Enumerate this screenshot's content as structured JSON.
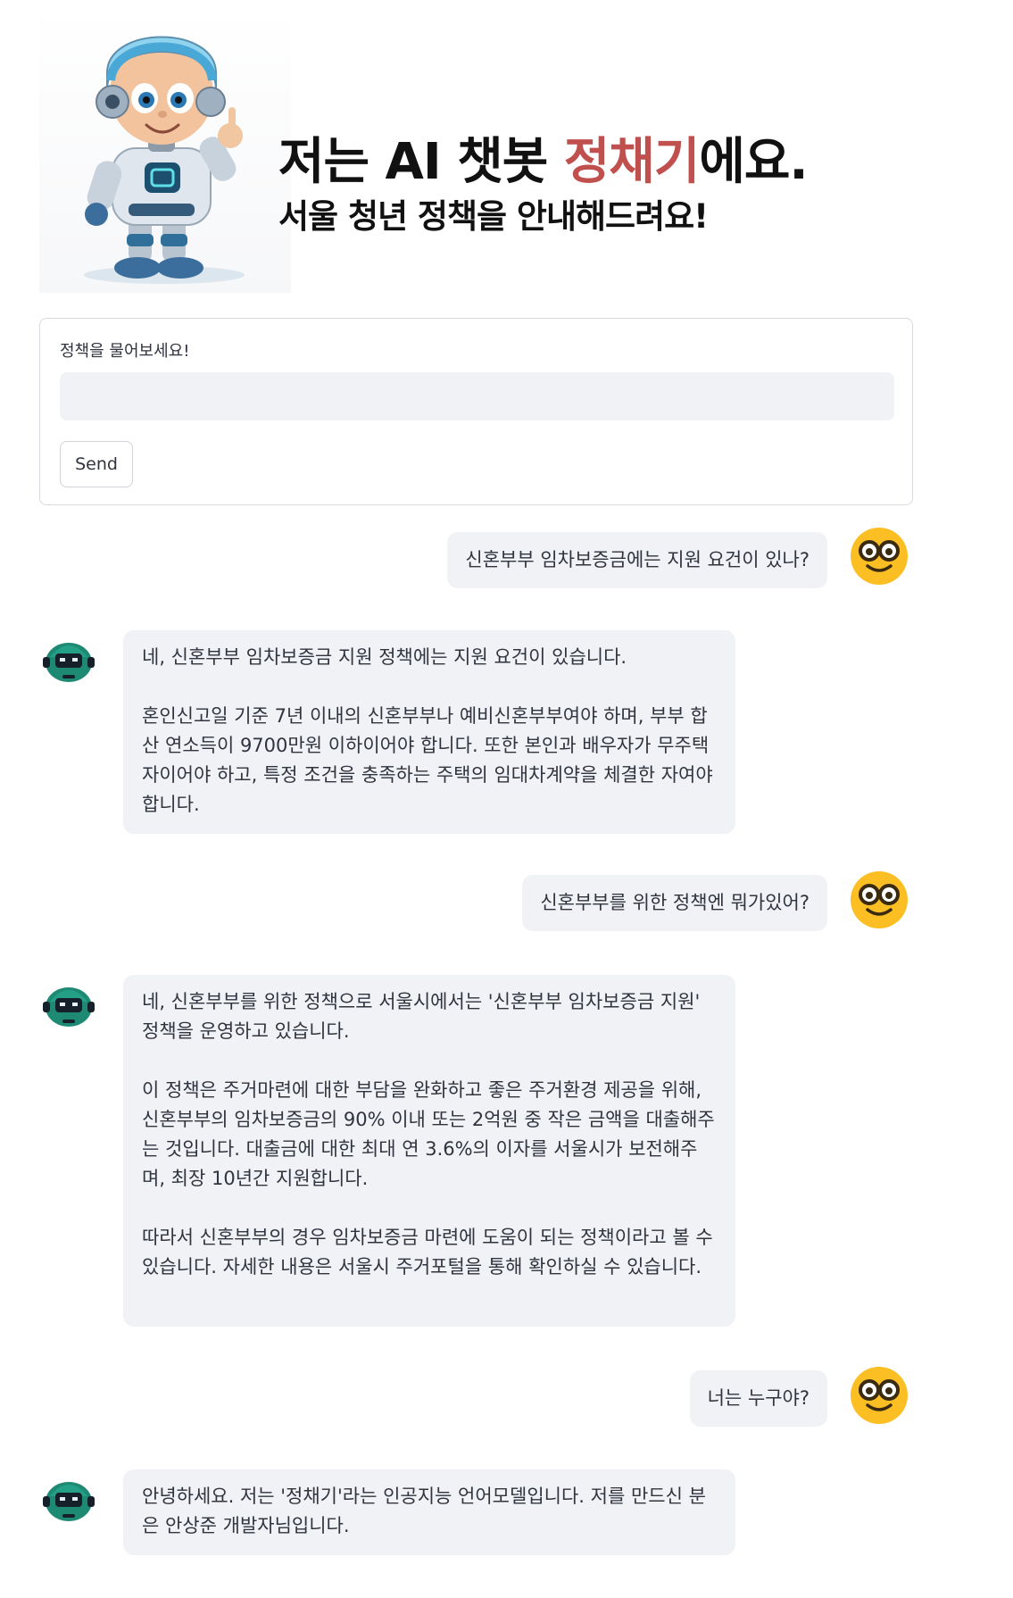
{
  "header": {
    "title_prefix": "저는 AI 챗봇 ",
    "title_accent": "정채기",
    "title_suffix": "에요.",
    "subtitle": "서울 청년 정책을 안내해드려요!",
    "accent_color": "#c0504d"
  },
  "form": {
    "label": "정책을 물어보세요!",
    "input_value": "",
    "send_label": "Send"
  },
  "messages": [
    {
      "role": "user",
      "text": "신혼부부 임차보증금에는 지원 요건이 있나?"
    },
    {
      "role": "bot",
      "paragraphs": [
        "네, 신혼부부 임차보증금 지원 정책에는 지원 요건이 있습니다.",
        "혼인신고일 기준 7년 이내의 신혼부부나 예비신혼부부여야 하며, 부부 합산 연소득이 9700만원 이하이어야 합니다. 또한 본인과 배우자가 무주택자이어야 하고, 특정 조건을 충족하는 주택의 임대차계약을 체결한 자여야 합니다."
      ]
    },
    {
      "role": "user",
      "text": "신혼부부를 위한 정책엔 뭐가있어?"
    },
    {
      "role": "bot",
      "paragraphs": [
        "네, 신혼부부를 위한 정책으로 서울시에서는 '신혼부부 임차보증금 지원' 정책을 운영하고 있습니다.",
        "이 정책은 주거마련에 대한 부담을 완화하고 좋은 주거환경 제공을 위해, 신혼부부의 임차보증금의 90% 이내 또는 2억원 중 작은 금액을 대출해주는 것입니다. 대출금에 대한 최대 연 3.6%의 이자를 서울시가 보전해주며, 최장 10년간 지원합니다.",
        "따라서 신혼부부의 경우 임차보증금 마련에 도움이 되는 정책이라고 볼 수 있습니다. 자세한 내용은 서울시 주거포털을 통해 확인하실 수 있습니다."
      ]
    },
    {
      "role": "user",
      "text": "너는 누구야?"
    },
    {
      "role": "bot",
      "paragraphs": [
        "안녕하세요. 저는 '정채기'라는 인공지능 언어모델입니다. 저를 만드신 분은 안상준 개발자님입니다."
      ]
    }
  ],
  "icons": {
    "user_avatar": "nerd-face-icon",
    "bot_avatar": "robot-icon",
    "header_image": "robot-mascot-icon"
  },
  "colors": {
    "bubble_bg": "#f0f2f6",
    "user_avatar_bg": "#fbbf24",
    "bot_avatar_bg": "#1f8a74"
  }
}
